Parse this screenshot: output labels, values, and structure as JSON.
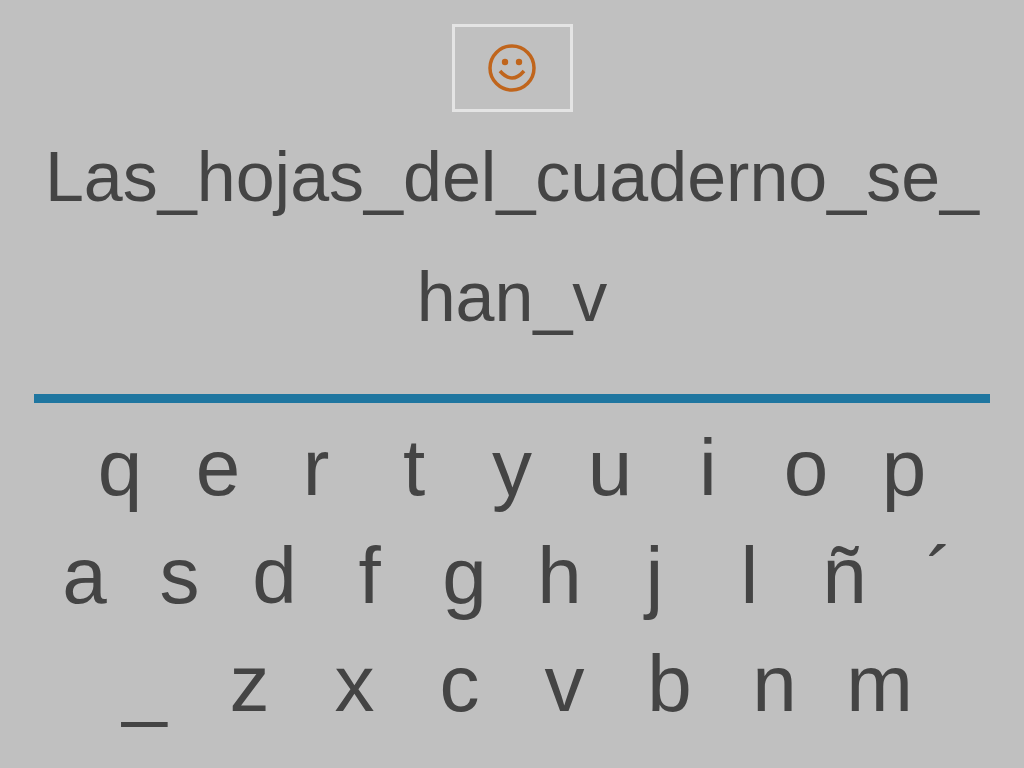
{
  "feedback_button": {
    "kind": "smiley"
  },
  "phrase_lines": [
    "Las_hojas_del_cuaderno_se_",
    "han_v"
  ],
  "keyboard_rows": [
    [
      "q",
      "e",
      "r",
      "t",
      "y",
      "u",
      "i",
      "o",
      "p"
    ],
    [
      "a",
      "s",
      "d",
      "f",
      "g",
      "h",
      "j",
      "l",
      "ñ",
      "´"
    ],
    [
      "_",
      "z",
      "x",
      "c",
      "v",
      "b",
      "n",
      "m"
    ]
  ]
}
